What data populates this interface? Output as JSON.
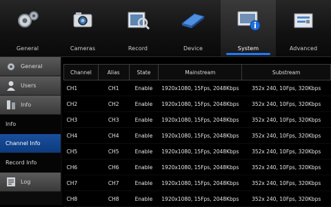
{
  "tabs": [
    {
      "label": "General",
      "icon": "gear-icon"
    },
    {
      "label": "Cameras",
      "icon": "camera-icon"
    },
    {
      "label": "Record",
      "icon": "record-icon"
    },
    {
      "label": "Device",
      "icon": "device-icon"
    },
    {
      "label": "System",
      "icon": "system-info-icon",
      "active": true
    },
    {
      "label": "Advanced",
      "icon": "advanced-icon"
    }
  ],
  "sidebar": [
    {
      "label": "General",
      "icon": "gear-icon"
    },
    {
      "label": "Users",
      "icon": "user-icon"
    },
    {
      "label": "Info",
      "icon": "info-icon"
    },
    {
      "label": "Info"
    },
    {
      "label": "Channel Info",
      "active": true
    },
    {
      "label": "Record Info"
    },
    {
      "label": "Log",
      "icon": "log-icon"
    }
  ],
  "table": {
    "headers": [
      "Channel",
      "Alias",
      "State",
      "Mainstream",
      "Substream"
    ],
    "rows": [
      [
        "CH1",
        "CH1",
        "Enable",
        "1920x1080, 15Fps, 2048Kbps",
        "352x 240, 10Fps, 320Kbps"
      ],
      [
        "CH2",
        "CH2",
        "Enable",
        "1920x1080, 15Fps, 2048Kbps",
        "352x 240, 10Fps, 320Kbps"
      ],
      [
        "CH3",
        "CH3",
        "Enable",
        "1920x1080, 15Fps, 2048Kbps",
        "352x 240, 10Fps, 320Kbps"
      ],
      [
        "CH4",
        "CH4",
        "Enable",
        "1920x1080, 15Fps, 2048Kbps",
        "352x 240, 10Fps, 320Kbps"
      ],
      [
        "CH5",
        "CH5",
        "Enable",
        "1920x1080, 15Fps, 2048Kbps",
        "352x 240, 10Fps, 320Kbps"
      ],
      [
        "CH6",
        "CH6",
        "Enable",
        "1920x1080, 15Fps, 2048Kbps",
        "352x 240, 10Fps, 320Kbps"
      ],
      [
        "CH7",
        "CH7",
        "Enable",
        "1920x1080, 15Fps, 2048Kbps",
        "352x 240, 10Fps, 320Kbps"
      ],
      [
        "CH8",
        "CH8",
        "Enable",
        "1920x1080, 15Fps, 2048Kbps",
        "352x 240, 10Fps, 320Kbps"
      ]
    ]
  },
  "colors": {
    "accent": "#1e7cff",
    "active_item": "#1a4f9e"
  }
}
